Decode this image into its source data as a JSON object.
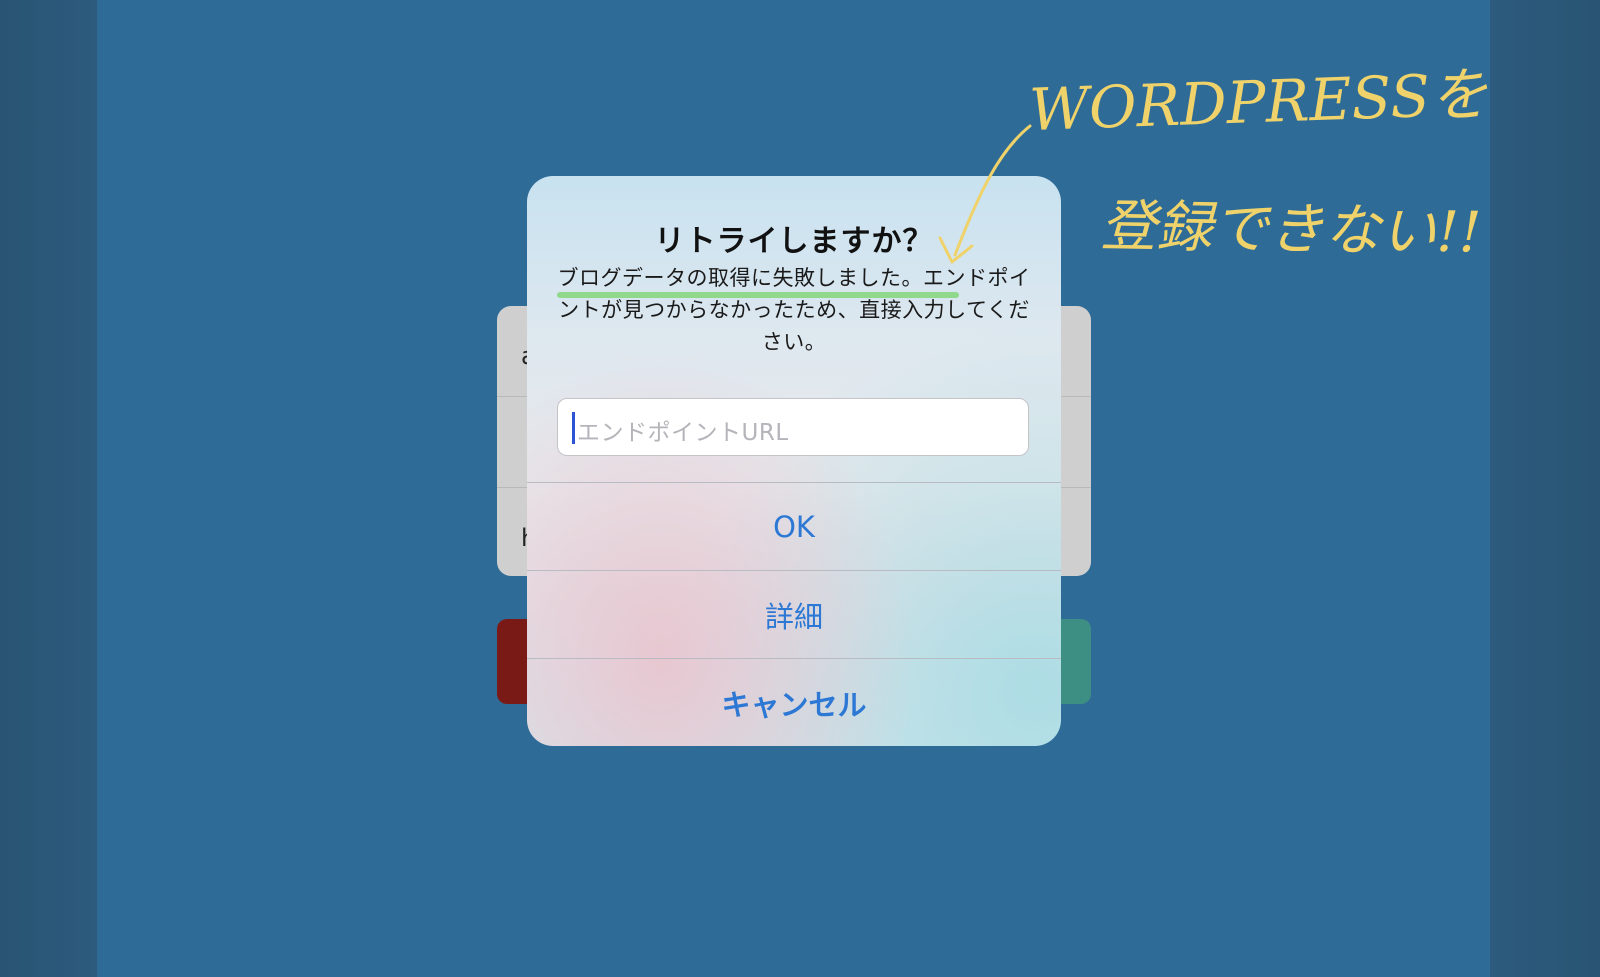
{
  "background_form": {
    "row1_text": "a",
    "row3_text": "h"
  },
  "alert": {
    "title": "リトライしますか？",
    "message": "ブログデータの取得に失敗しました。エンドポイントが見つからなかったため、直接入力してください。",
    "input_placeholder": "エンドポイントURL",
    "input_value": "",
    "buttons": {
      "ok": "OK",
      "detail": "詳細",
      "cancel": "キャンセル"
    }
  },
  "annotation": {
    "line1": "WORDPRESSを",
    "line2": "登録できない!!"
  },
  "colors": {
    "background": "#2f6b97",
    "button_text": "#2c78d4",
    "highlight": "#8fd88c",
    "annotation": "#efd36a"
  }
}
